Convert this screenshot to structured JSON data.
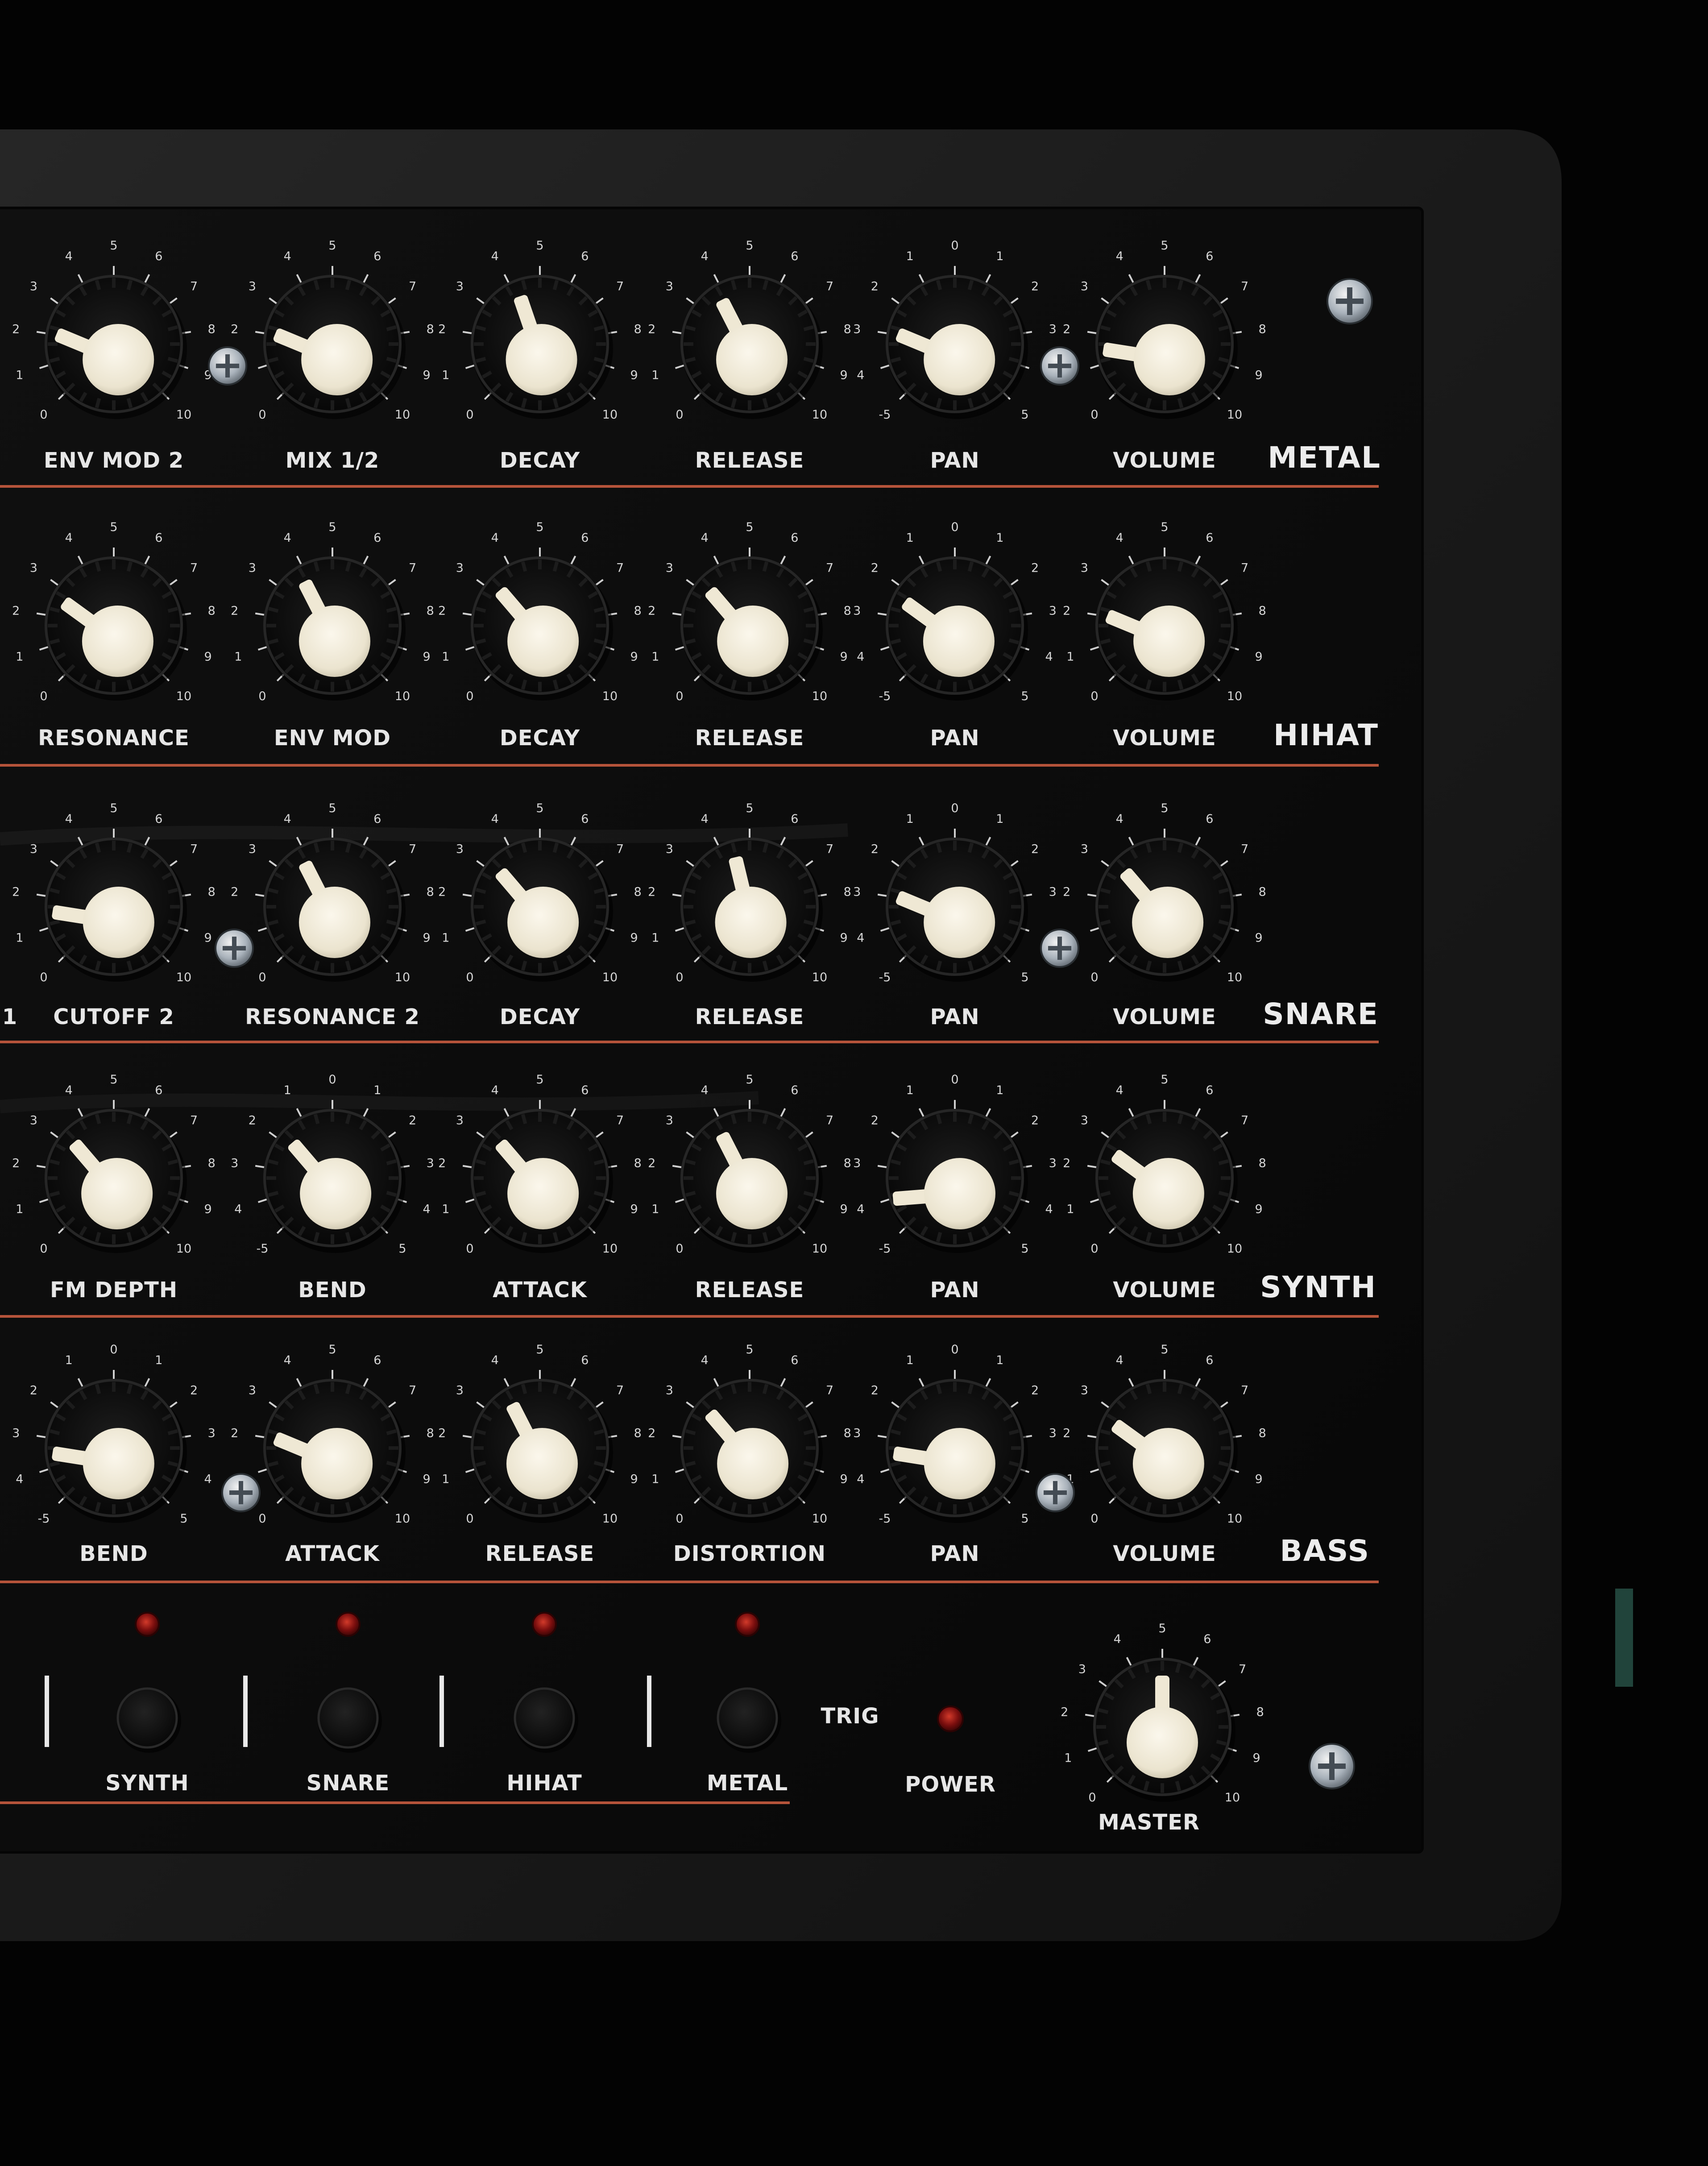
{
  "colors": {
    "background": "#030303",
    "case": "#1b1b1b",
    "panel": "#0b0b0b",
    "accent_line": "#b5533a",
    "knob_cap": "#f2ecd9",
    "led": "#7a0e0e",
    "text": "#e6e6e6"
  },
  "panel": {
    "rows": [
      {
        "name": "METAL",
        "knobs": [
          {
            "label": "ENV MOD 2",
            "scale": "0-10",
            "value": 2.5
          },
          {
            "label": "MIX 1/2",
            "scale": "0-10",
            "value": 2.5
          },
          {
            "label": "DECAY",
            "scale": "0-10",
            "value": 4.3
          },
          {
            "label": "RELEASE",
            "scale": "0-10",
            "value": 4.0
          },
          {
            "label": "PAN",
            "scale": "pan",
            "value": -2.5
          },
          {
            "label": "VOLUME",
            "scale": "0-10",
            "value": 2.0
          }
        ]
      },
      {
        "name": "HIHAT",
        "knobs": [
          {
            "label": "RESONANCE",
            "scale": "0-10",
            "value": 3.0
          },
          {
            "label": "ENV MOD",
            "scale": "0-10",
            "value": 4.0
          },
          {
            "label": "DECAY",
            "scale": "0-10",
            "value": 3.5
          },
          {
            "label": "RELEASE",
            "scale": "0-10",
            "value": 3.5
          },
          {
            "label": "PAN",
            "scale": "pan",
            "value": -2.0
          },
          {
            "label": "VOLUME",
            "scale": "0-10",
            "value": 2.5
          }
        ]
      },
      {
        "name": "SNARE",
        "knobs": [
          {
            "label": "CUTOFF 2",
            "scale": "0-10",
            "value": 2.0
          },
          {
            "label": "RESONANCE 2",
            "scale": "0-10",
            "value": 4.0
          },
          {
            "label": "DECAY",
            "scale": "0-10",
            "value": 3.5
          },
          {
            "label": "RELEASE",
            "scale": "0-10",
            "value": 4.5
          },
          {
            "label": "PAN",
            "scale": "pan",
            "value": -2.5
          },
          {
            "label": "VOLUME",
            "scale": "0-10",
            "value": 3.5
          }
        ]
      },
      {
        "name": "SYNTH",
        "knobs": [
          {
            "label": "FM DEPTH",
            "scale": "0-10",
            "value": 3.5
          },
          {
            "label": "BEND",
            "scale": "pan",
            "value": -1.5
          },
          {
            "label": "ATTACK",
            "scale": "0-10",
            "value": 3.5
          },
          {
            "label": "RELEASE",
            "scale": "0-10",
            "value": 4.0
          },
          {
            "label": "PAN",
            "scale": "pan",
            "value": -3.5
          },
          {
            "label": "VOLUME",
            "scale": "0-10",
            "value": 3.0
          }
        ]
      },
      {
        "name": "BASS",
        "knobs": [
          {
            "label": "BEND",
            "scale": "pan",
            "value": -3.0
          },
          {
            "label": "ATTACK",
            "scale": "0-10",
            "value": 2.5
          },
          {
            "label": "RELEASE",
            "scale": "0-10",
            "value": 4.0
          },
          {
            "label": "DISTORTION",
            "scale": "0-10",
            "value": 3.5
          },
          {
            "label": "PAN",
            "scale": "pan",
            "value": -3.0
          },
          {
            "label": "VOLUME",
            "scale": "0-10",
            "value": 3.0
          }
        ]
      }
    ],
    "partial_label": "1",
    "trigger_buttons": [
      "SYNTH",
      "SNARE",
      "HIHAT",
      "METAL"
    ],
    "trig_label": "TRIG",
    "power_label": "POWER",
    "master": {
      "label": "MASTER",
      "scale": "0-10",
      "value": 5.0
    },
    "scale_ticks": {
      "zero_ten": [
        "0",
        "1",
        "2",
        "3",
        "4",
        "5",
        "6",
        "7",
        "8",
        "9",
        "10"
      ],
      "pan": [
        "-5",
        "4",
        "3",
        "2",
        "1",
        "0",
        "1",
        "2",
        "3",
        "4",
        "5"
      ]
    }
  }
}
